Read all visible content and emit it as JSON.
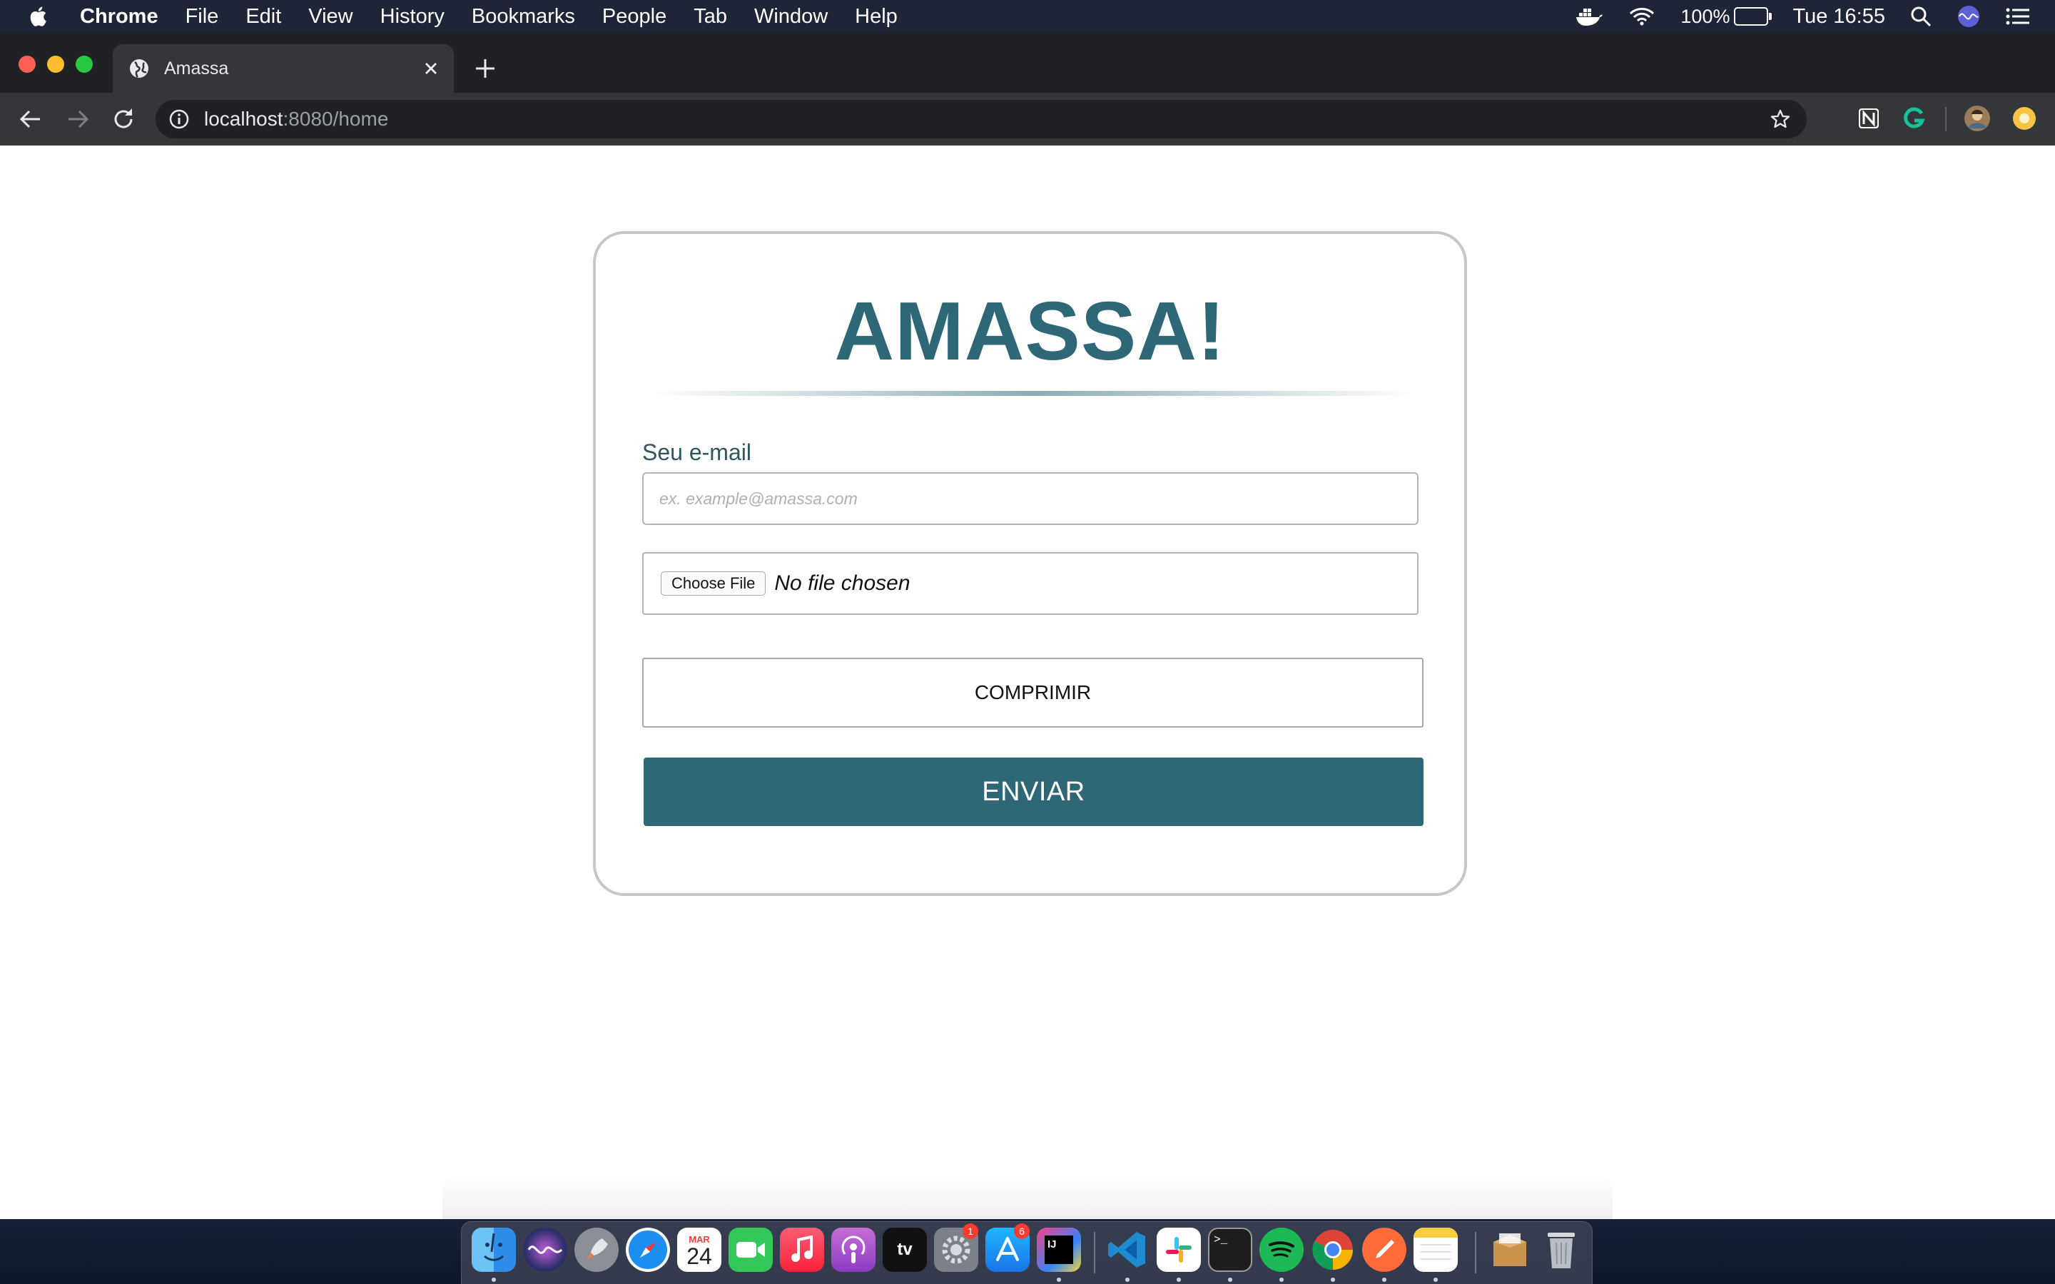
{
  "menubar": {
    "items": [
      "Chrome",
      "File",
      "Edit",
      "View",
      "History",
      "Bookmarks",
      "People",
      "Tab",
      "Window",
      "Help"
    ],
    "battery": "100%",
    "clock": "Tue 16:55"
  },
  "browser": {
    "tab_title": "Amassa",
    "url_host": "localhost",
    "url_path": ":8080/home"
  },
  "form": {
    "title": "AMASSA!",
    "email_label": "Seu e-mail",
    "email_placeholder": "ex. example@amassa.com",
    "email_value": "",
    "choose_file_label": "Choose File",
    "file_status": "No file chosen",
    "compress_label": "COMPRIMIR",
    "send_label": "ENVIAR"
  },
  "dock": {
    "calendar_month": "MAR",
    "calendar_day": "24",
    "tv_label": "tv",
    "intellij_label": "IJ",
    "terminal_prompt": ">_",
    "system_prefs_badge": "1",
    "app_store_badge": "6"
  },
  "colors": {
    "accent": "#2e6877",
    "menubar_bg": "#1e2536",
    "tabstrip_bg": "#202124",
    "toolbar_bg": "#35363a"
  }
}
